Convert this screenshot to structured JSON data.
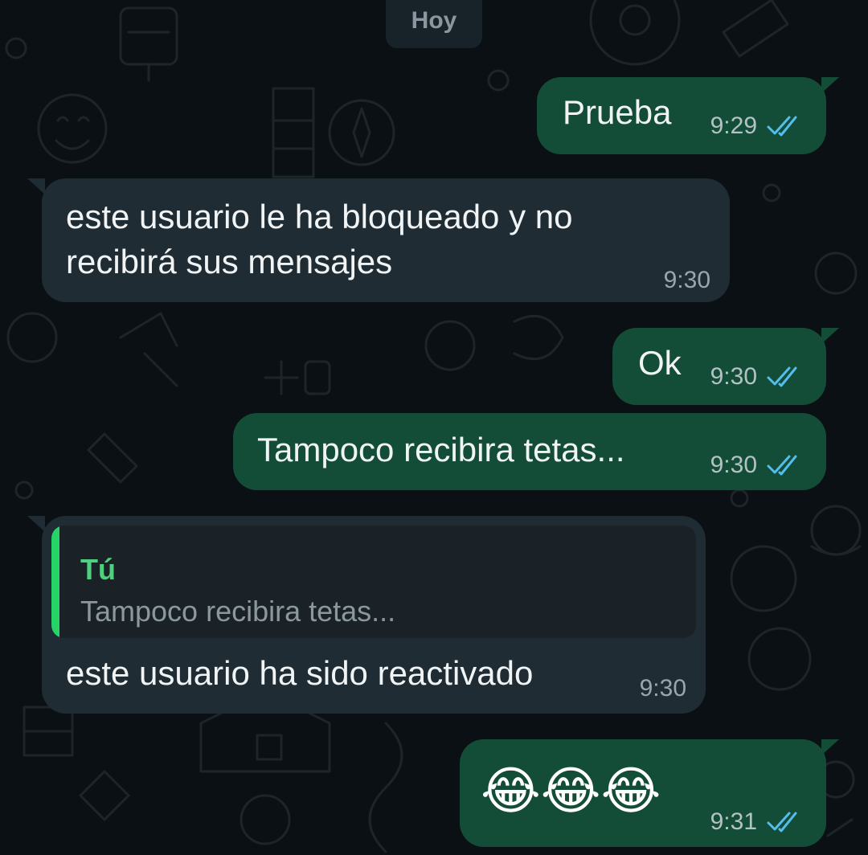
{
  "chat": {
    "date_chip": "Hoy",
    "messages": [
      {
        "id": "m1",
        "direction": "outgoing",
        "text": "Prueba",
        "time": "9:29",
        "status": "read"
      },
      {
        "id": "m2",
        "direction": "incoming",
        "text": "este usuario le ha bloqueado y no recibirá sus mensajes",
        "time": "9:30"
      },
      {
        "id": "m3",
        "direction": "outgoing",
        "text": "Ok",
        "time": "9:30",
        "status": "read"
      },
      {
        "id": "m4",
        "direction": "outgoing",
        "text": "Tampoco recibira tetas...",
        "time": "9:30",
        "status": "read"
      },
      {
        "id": "m5",
        "direction": "incoming",
        "quote": {
          "author": "Tú",
          "text": "Tampoco recibira tetas..."
        },
        "text": "este usuario ha sido reactivado",
        "time": "9:30"
      },
      {
        "id": "m6",
        "direction": "outgoing",
        "text": "😂😂😂",
        "time": "9:31",
        "status": "read"
      }
    ]
  },
  "colors": {
    "background": "#0b1014",
    "outgoing_bubble": "#144d37",
    "incoming_bubble": "#202c33",
    "read_tick": "#53bdeb",
    "quote_accent": "#25d366"
  },
  "icons": {
    "read_receipt": "double-check-icon"
  }
}
